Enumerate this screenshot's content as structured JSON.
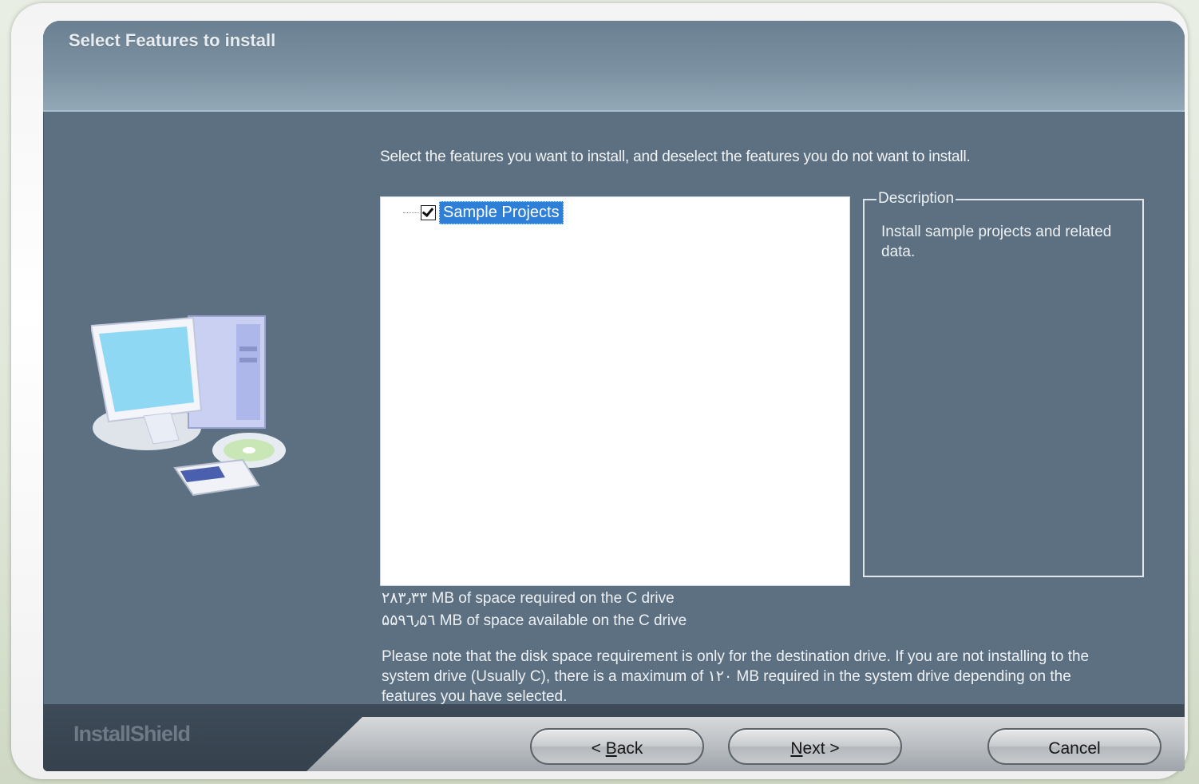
{
  "header": {
    "title": "Select Features to install"
  },
  "instructions": "Select the features you want to install, and deselect the features you do not want to install.",
  "features": [
    {
      "label": "Sample Projects",
      "checked": true,
      "selected": true
    }
  ],
  "description": {
    "legend": "Description",
    "text": "Install sample projects and related data."
  },
  "space": {
    "required": "۲۸۳٫۳۳ MB of space required on the C drive",
    "available": "۵۵۹٦٫۵٦ MB of space available on the C drive"
  },
  "note": "Please note that the disk space requirement is only for the destination drive. If you are not installing to the system drive (Usually C), there is a maximum of ۱۲۰ MB required in the system drive depending on the features you have selected.",
  "footer": {
    "brand": "InstallShield",
    "back_prefix": "< ",
    "back_underlined": "B",
    "back_rest": "ack",
    "next_underlined": "N",
    "next_rest": "ext >",
    "cancel": "Cancel"
  },
  "colors": {
    "dialog_bg": "#5c7082",
    "selection": "#2f7fd8"
  }
}
